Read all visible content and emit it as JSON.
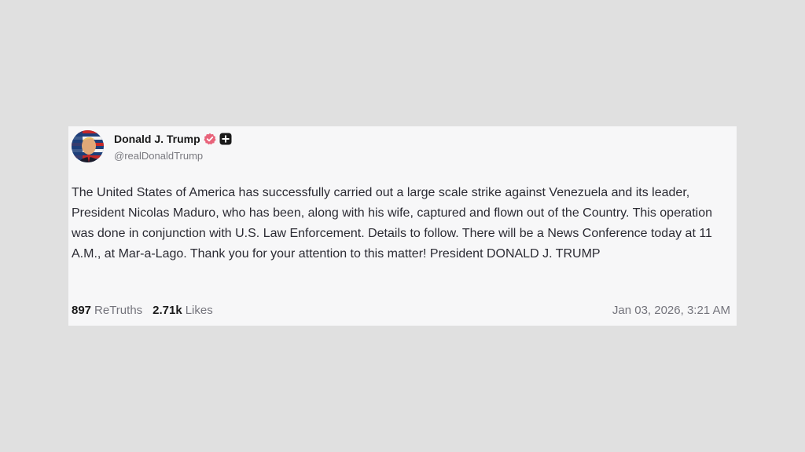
{
  "post": {
    "author": {
      "display_name": "Donald J. Trump",
      "handle": "@realDonaldTrump",
      "avatar_icon": "profile-avatar",
      "verified_icon": "verified-check-icon",
      "plus_icon": "plus-badge-icon"
    },
    "text": "The United States of America has successfully carried out a large scale strike against Venezuela and its leader, President Nicolas Maduro, who has been, along with his wife, captured and flown out of the Country. This operation was done in conjunction with U.S. Law Enforcement. Details to follow. There will be a News Conference today at 11 A.M., at Mar-a-Lago. Thank you for your attention to this matter! President DONALD J. TRUMP",
    "stats": {
      "retruths_count": "897",
      "retruths_label": "ReTruths",
      "likes_count": "2.71k",
      "likes_label": "Likes"
    },
    "timestamp": "Jan 03, 2026, 3:21 AM"
  },
  "colors": {
    "page_background": "#e0e0e0",
    "card_background": "#f7f7f8",
    "verified_badge": "#e8637a",
    "muted_text": "#74747c"
  }
}
